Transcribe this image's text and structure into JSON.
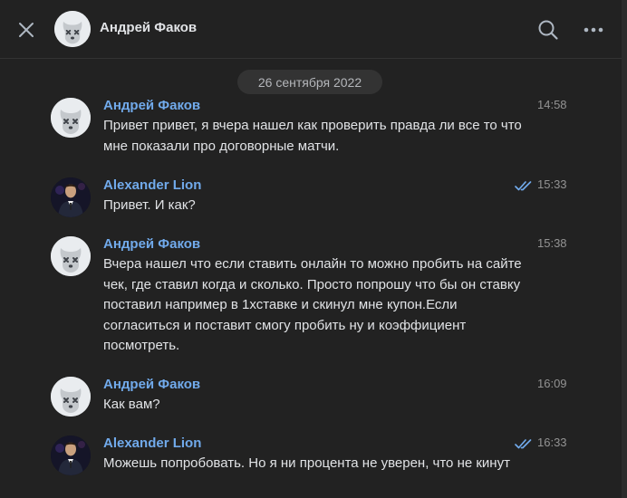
{
  "header": {
    "title": "Андрей Факов",
    "close_icon": "close-icon",
    "search_icon": "search-icon",
    "more_icon": "more-icon"
  },
  "date_divider": "26 сентября 2022",
  "colors": {
    "background": "#222222",
    "author_name": "#71aaeb",
    "text": "#e1e3e6",
    "time": "#939393",
    "read_check": "#71aaeb"
  },
  "messages": [
    {
      "author": "Андрей Факов",
      "time": "14:58",
      "read": false,
      "text": "Привет привет, я вчера нашел как проверить правда ли все то что мне показали про договорные матчи."
    },
    {
      "author": "Alexander Lion",
      "time": "15:33",
      "read": true,
      "text": "Привет. И как?"
    },
    {
      "author": "Андрей Факов",
      "time": "15:38",
      "read": false,
      "text": "Вчера нашел что если ставить онлайн то можно пробить на сайте чек, где ставил когда и сколько. Просто попрошу что бы он ставку поставил например в 1хставке и скинул мне купон.Если согласиться и поставит смогу пробить ну и коэффициент посмотреть."
    },
    {
      "author": "Андрей Факов",
      "time": "16:09",
      "read": false,
      "text": "Как вам?"
    },
    {
      "author": "Alexander Lion",
      "time": "16:33",
      "read": true,
      "text": "Можешь попробовать. Но я ни процента не уверен, что не кинут"
    }
  ]
}
